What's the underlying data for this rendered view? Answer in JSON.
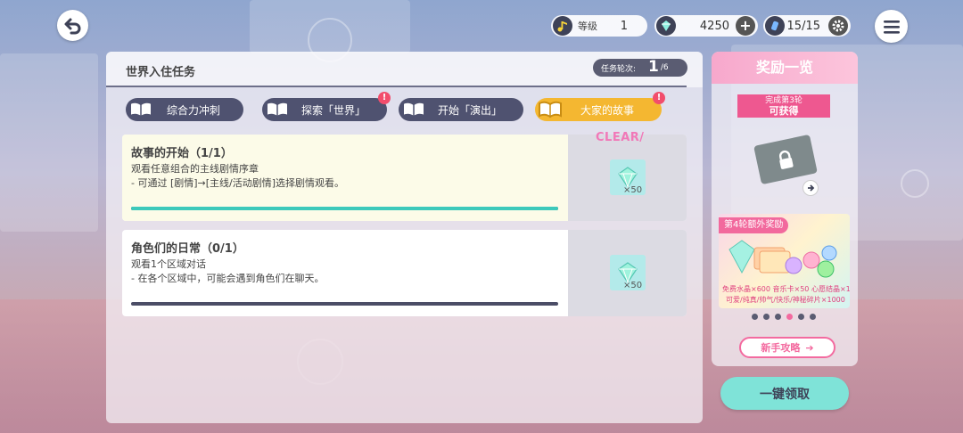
{
  "topbar": {
    "level_label": "等级",
    "level_value": "1",
    "crystals": "4250",
    "stamina": "15/15"
  },
  "mission": {
    "title": "世界入住任务",
    "round_label": "任务轮次:",
    "round_current": "1",
    "round_total": "/6"
  },
  "tabs": [
    {
      "label": "综合力冲刺",
      "active": false,
      "badge": false
    },
    {
      "label": "探索「世界」",
      "active": false,
      "badge": true
    },
    {
      "label": "开始「演出」",
      "active": false,
      "badge": false
    },
    {
      "label": "大家的故事",
      "active": true,
      "badge": true
    }
  ],
  "badge_symbol": "!",
  "tasks": [
    {
      "title": "故事的开始（1/1）",
      "desc1": "观看任意组合的主线剧情序章",
      "desc2": "- 可通过 [剧情]→[主线/活动剧情]选择剧情观看。",
      "progress": 1.0,
      "reward_qty": "×50",
      "clear": "CLEAR/"
    },
    {
      "title": "角色们的日常（0/1）",
      "desc1": "观看1个区域对话",
      "desc2": "- 在各个区域中，可能会遇到角色们在聊天。",
      "progress": 0.0,
      "reward_qty": "×50"
    }
  ],
  "rewards": {
    "header": "奖励一览",
    "ribbon_top": "完成第3轮",
    "ribbon_main": "可获得",
    "extra_title": "第4轮额外奖励",
    "extra_line1": "免费水晶×600  音乐卡×50  心愿结晶×1",
    "extra_line2": "可爱/纯真/帅气/快乐/神秘碎片×1000",
    "dots_active_index": 3,
    "guide_label": "新手攻略"
  },
  "claim_all": "一键领取",
  "colors": {
    "tab_dark": "#4f5270",
    "tab_active": "#f4b731",
    "progress_fill": "#3cc9bb",
    "accent_pink": "#f36a9f",
    "claim": "#7fe3d8"
  }
}
